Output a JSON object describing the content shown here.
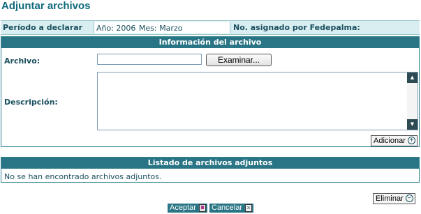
{
  "page": {
    "title": "Adjuntar archivos"
  },
  "period": {
    "label": "Período a declarar",
    "year": "Año: 2006",
    "month": "Mes: Marzo",
    "assigned_label": "No. asignado por Fedepalma:"
  },
  "info_panel": {
    "header": "Información del archivo",
    "file_label": "Archivo:",
    "file_value": "",
    "browse_label": "Examinar...",
    "description_label": "Descripción:",
    "description_value": "",
    "add_label": "Adicionar"
  },
  "list_panel": {
    "header": "Listado de archivos adjuntos",
    "empty_text": "No se han encontrado archivos adjuntos."
  },
  "actions": {
    "delete_label": "Eliminar",
    "accept_label": "Aceptar",
    "cancel_label": "Cancelar"
  },
  "icons": {
    "add": "plus-circle-icon",
    "delete": "minus-circle-icon",
    "accept": "accept-icon",
    "cancel": "close-icon"
  },
  "colors": {
    "title": "#0f6a7c",
    "header_bg": "#2a7585",
    "band_bg": "#d9eef0",
    "text": "#1a4f5f"
  }
}
